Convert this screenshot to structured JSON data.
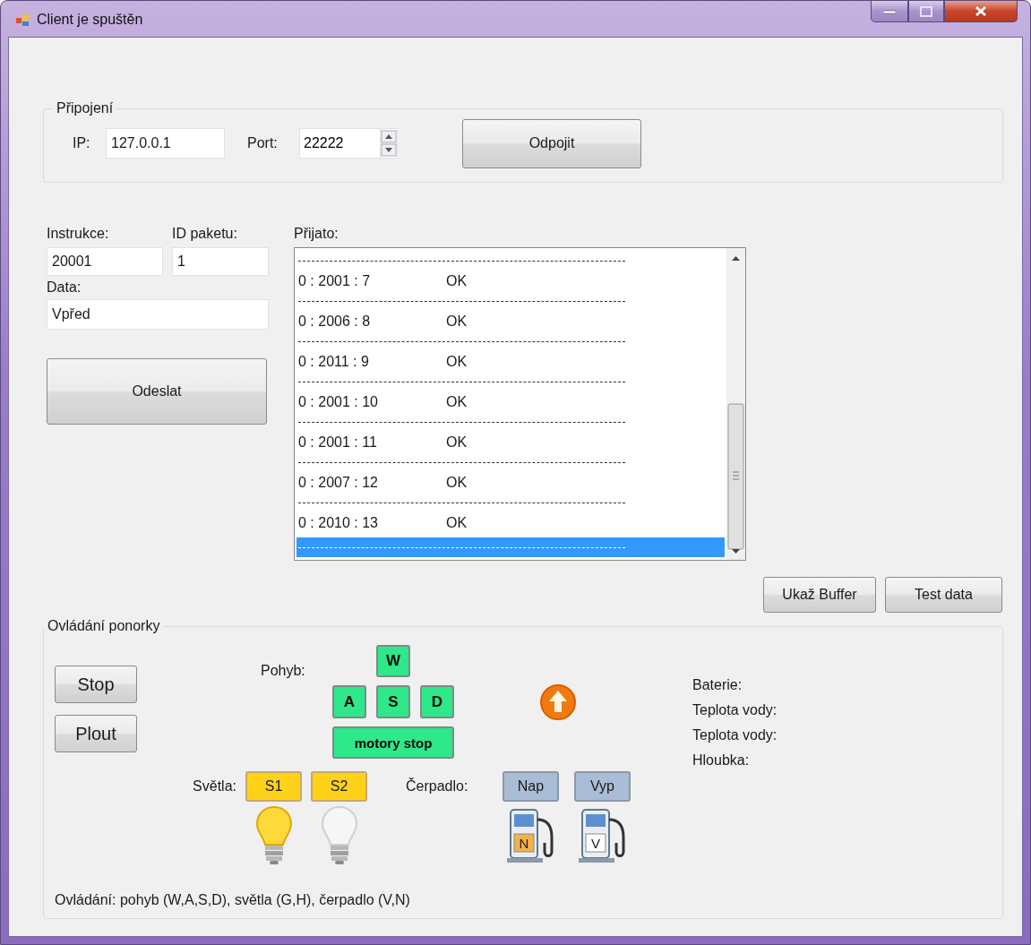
{
  "window": {
    "title": "Client je spuštěn"
  },
  "connection": {
    "title": "Připojení",
    "ip_label": "IP:",
    "ip": "127.0.0.1",
    "port_label": "Port:",
    "port": "22222",
    "button": "Odpojit"
  },
  "packet": {
    "instruction_label": "Instrukce:",
    "instruction": "20001",
    "id_label": "ID paketu:",
    "id": "1",
    "data_label": "Data:",
    "data": "Vpřed",
    "send_button": "Odeslat"
  },
  "received": {
    "label": "Přijato:",
    "items": [
      {
        "kind": "separator",
        "selected": false
      },
      {
        "kind": "entry",
        "code": "0 : 2001 : 7",
        "status": "OK",
        "selected": false
      },
      {
        "kind": "separator",
        "selected": false
      },
      {
        "kind": "entry",
        "code": "0 : 2006 : 8",
        "status": "OK",
        "selected": false
      },
      {
        "kind": "separator",
        "selected": false
      },
      {
        "kind": "entry",
        "code": "0 : 2011 : 9",
        "status": "OK",
        "selected": false
      },
      {
        "kind": "separator",
        "selected": false
      },
      {
        "kind": "entry",
        "code": "0 : 2001 : 10",
        "status": "OK",
        "selected": false
      },
      {
        "kind": "separator",
        "selected": false
      },
      {
        "kind": "entry",
        "code": "0 : 2001 : 11",
        "status": "OK",
        "selected": false
      },
      {
        "kind": "separator",
        "selected": false
      },
      {
        "kind": "entry",
        "code": "0 : 2007 : 12",
        "status": "OK",
        "selected": false
      },
      {
        "kind": "separator",
        "selected": false
      },
      {
        "kind": "entry",
        "code": "0 : 2010 : 13",
        "status": "OK",
        "selected": false
      },
      {
        "kind": "separator",
        "selected": true
      }
    ]
  },
  "buttons": [
    "Ukaž Buffer",
    "Test data"
  ],
  "control": {
    "title": "Ovládání ponorky",
    "actions": [
      "Stop",
      "Plout"
    ],
    "movement_label": "Pohyb:",
    "keys": [
      "W",
      "A",
      "S",
      "D",
      "motory stop"
    ],
    "lights_label": "Světla:",
    "lights": [
      {
        "label": "S1",
        "on": true
      },
      {
        "label": "S2",
        "on": false
      }
    ],
    "pump_label": "Čerpadlo:",
    "pump": [
      {
        "label": "Nap",
        "letter": "N",
        "active": true
      },
      {
        "label": "Vyp",
        "letter": "V",
        "active": false
      }
    ],
    "sensors": [
      "Baterie:",
      "Teplota vody:",
      "Teplota vody:",
      "Hloubka:"
    ],
    "hint": "Ovládání: pohyb (W,A,S,D), světla (G,H), čerpadlo (V,N)"
  }
}
